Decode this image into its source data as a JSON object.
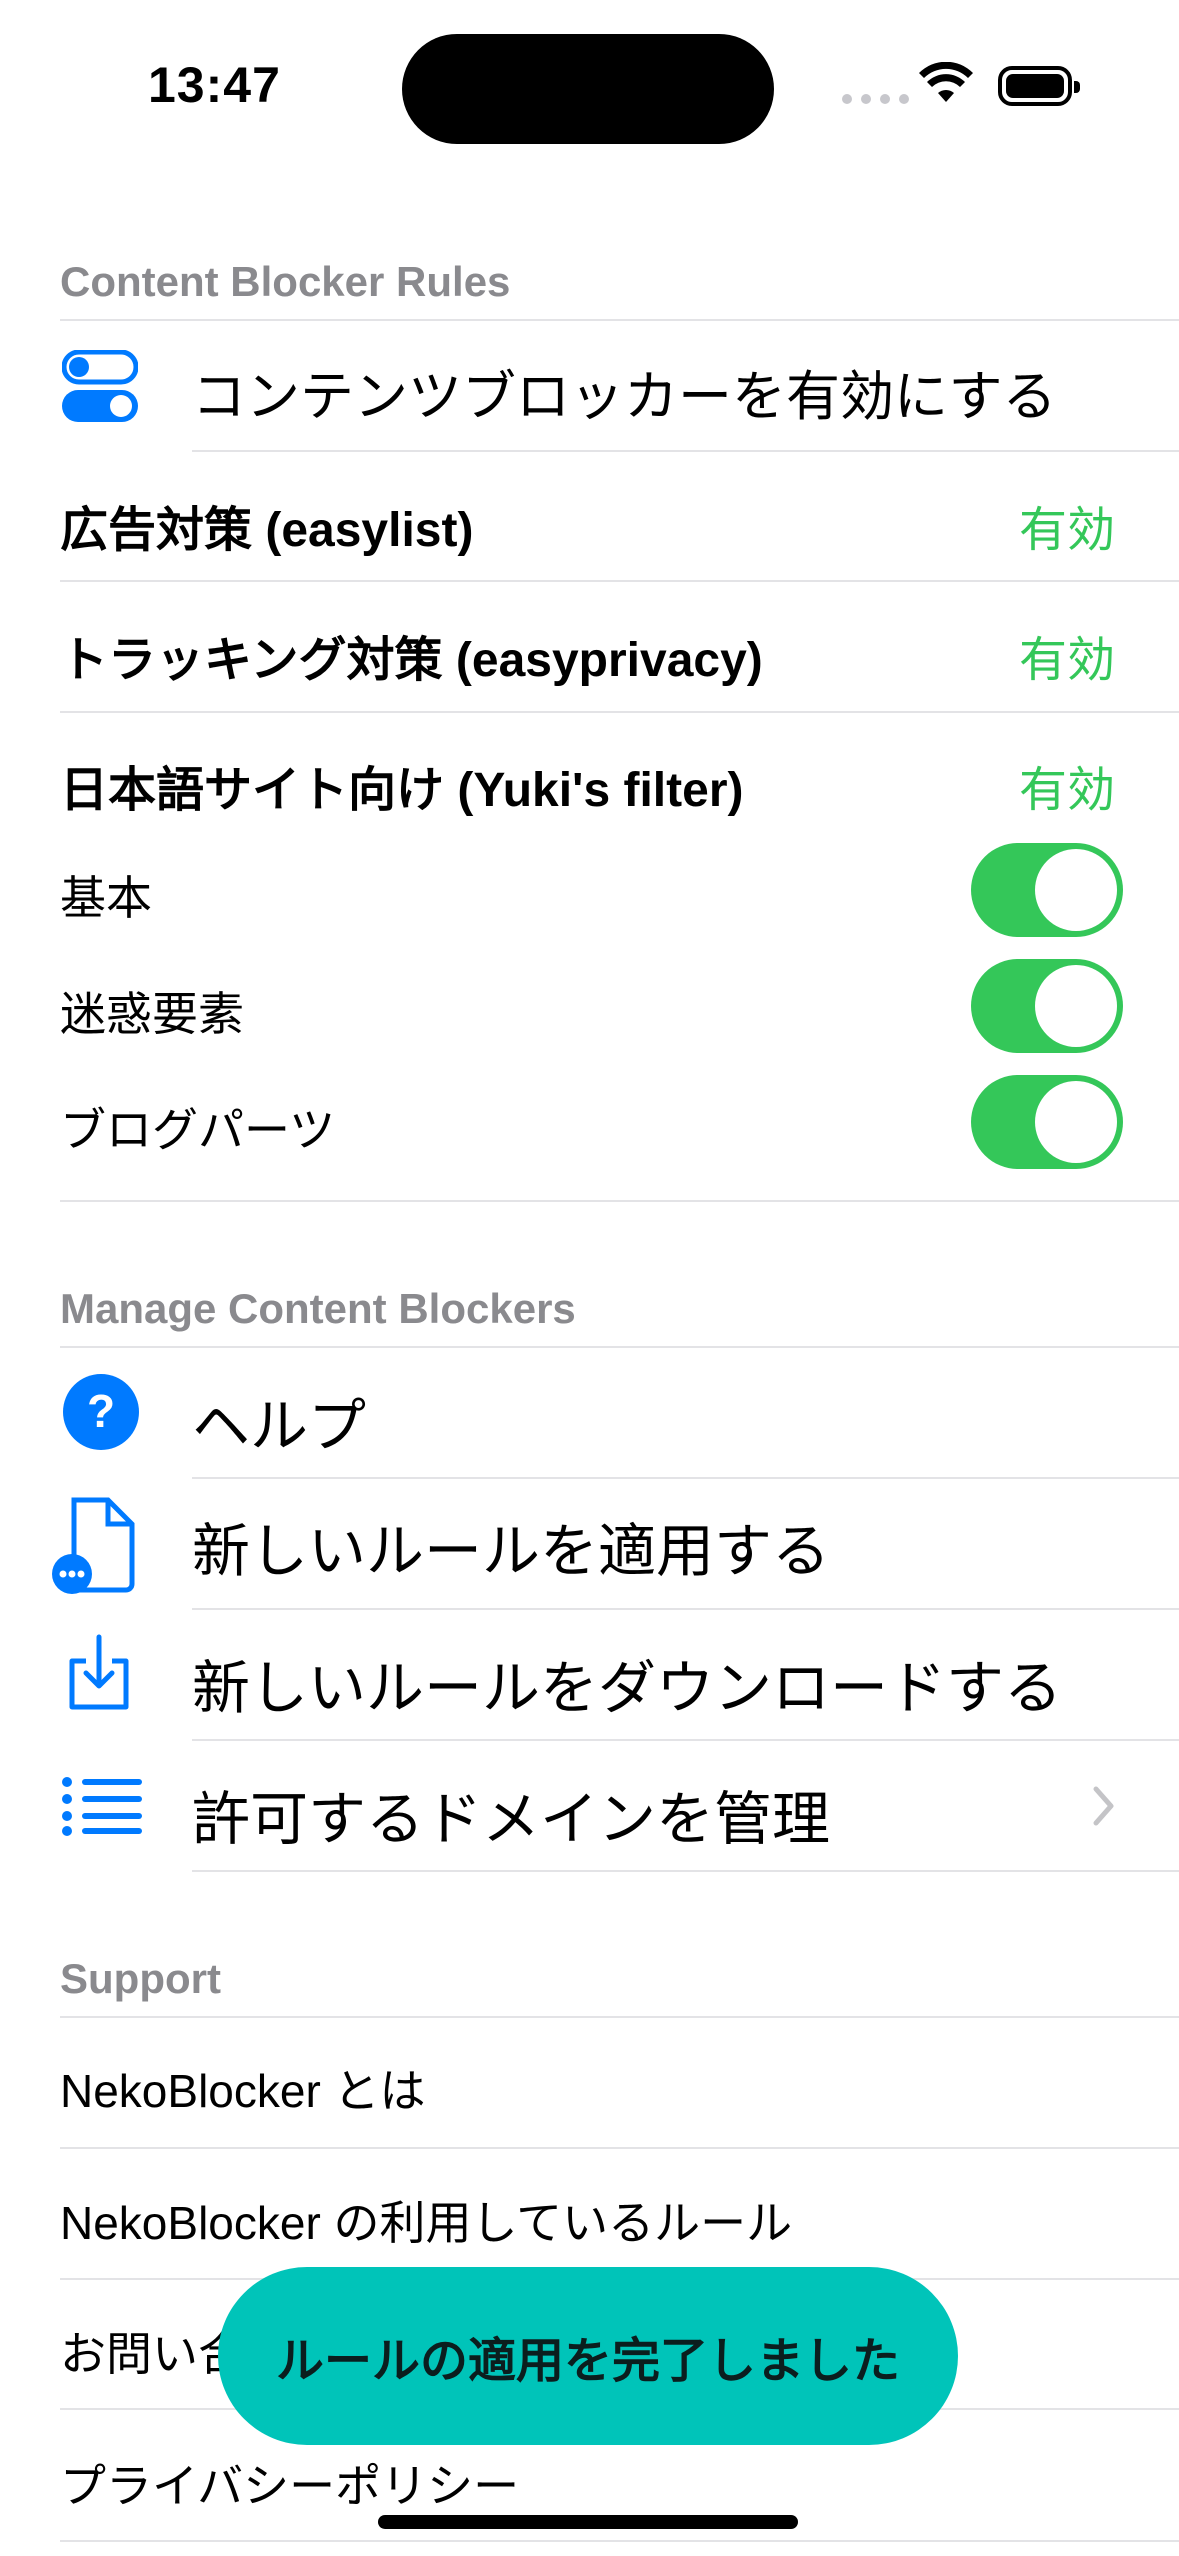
{
  "status_bar": {
    "time": "13:47"
  },
  "sections": {
    "rules_header": "Content Blocker Rules",
    "manage_header": "Manage Content Blockers",
    "support_header": "Support"
  },
  "rules": {
    "enable_label": "コンテンツブロッカーを有効にする",
    "easylist_label": "広告対策 (easylist)",
    "easylist_status": "有効",
    "easyprivacy_label": "トラッキング対策 (easyprivacy)",
    "easyprivacy_status": "有効",
    "yuki_label": "日本語サイト向け (Yuki's filter)",
    "yuki_status": "有効",
    "toggles": [
      {
        "label": "基本",
        "on": true
      },
      {
        "label": "迷惑要素",
        "on": true
      },
      {
        "label": "ブログパーツ",
        "on": true
      }
    ]
  },
  "manage": {
    "help": "ヘルプ",
    "apply": "新しいルールを適用する",
    "download": "新しいルールをダウンロードする",
    "domains": "許可するドメインを管理"
  },
  "support": {
    "about": "NekoBlocker とは",
    "rules_used": "NekoBlocker の利用しているルール",
    "contact": "お問い合わせ",
    "privacy": "プライバシーポリシー"
  },
  "toast": "ルールの適用を完了しました",
  "colors": {
    "accent": "#007aff",
    "green": "#34c759",
    "toast": "#00c4b9"
  }
}
